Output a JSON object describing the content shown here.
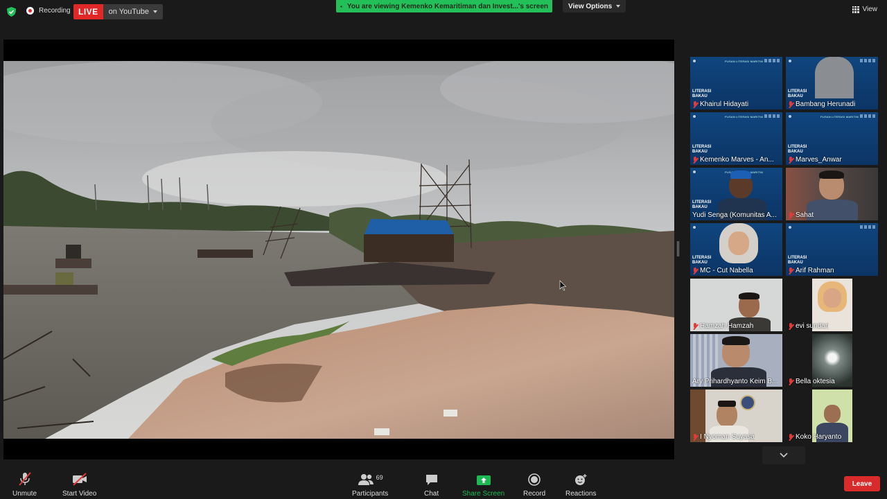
{
  "topbar": {
    "recording_label": "Recording",
    "live_badge": "LIVE",
    "live_target": "on YouTube",
    "viewing_banner": "You are viewing Kemenko Kemaritiman dan Invest...'s screen",
    "view_options": "View Options",
    "view_label": "View"
  },
  "slide": {
    "header": "PUSAN LITERASI MARITIM",
    "title_line1": "LITERASI",
    "title_line2": "BAKAU"
  },
  "participants": [
    {
      "name": "Khairul Hidayati"
    },
    {
      "name": "Bambang Herunadi"
    },
    {
      "name": "Kemenko Marves - An..."
    },
    {
      "name": "Marves_Anwar"
    },
    {
      "name": "Yudi Senga (Komunitas A..."
    },
    {
      "name": "Sahat"
    },
    {
      "name": "MC - Cut Nabella"
    },
    {
      "name": "Arif Rahman"
    },
    {
      "name": "Hamzah Hamzah"
    },
    {
      "name": "evi sundari"
    },
    {
      "name": "Ary Prihardhyanto Keim B..."
    },
    {
      "name": "Bella oktesia"
    },
    {
      "name": "I Nyoman Suyasa"
    },
    {
      "name": "Koko Haryanto"
    }
  ],
  "toolbar": {
    "unmute": "Unmute",
    "start_video": "Start Video",
    "participants_label": "Participants",
    "participants_count": "69",
    "chat": "Chat",
    "share_screen": "Share Screen",
    "record": "Record",
    "reactions": "Reactions",
    "leave": "Leave"
  },
  "colors": {
    "live_red": "#e02828",
    "banner_green": "#23c05a",
    "share_green": "#1db954",
    "active_speaker": "#e4e441",
    "leave_red": "#d92b2b"
  }
}
